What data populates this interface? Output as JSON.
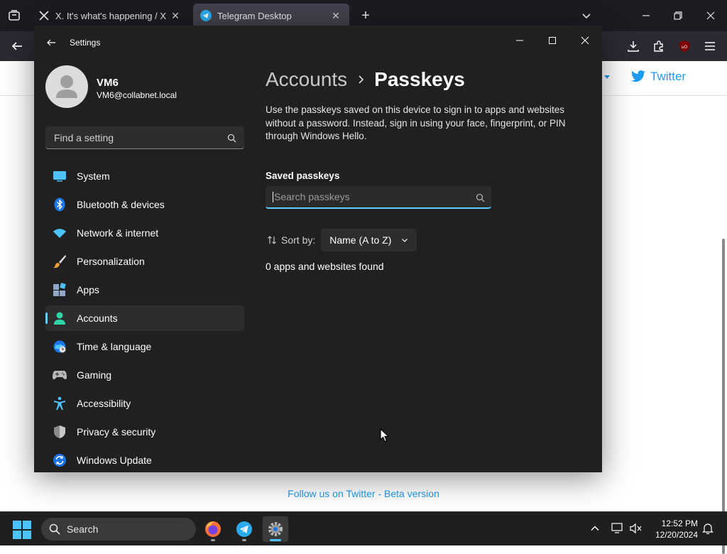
{
  "browser": {
    "tabs": [
      {
        "title": "X. It's what's happening / X",
        "active": false
      },
      {
        "title": "Telegram Desktop",
        "active": true
      }
    ]
  },
  "webpage": {
    "twitter_link": "Twitter",
    "footer_link": "Follow us on Twitter - Beta version"
  },
  "settings": {
    "window_title": "Settings",
    "profile": {
      "name": "VM6",
      "email": "VM6@collabnet.local"
    },
    "find_placeholder": "Find a setting",
    "nav": [
      {
        "label": "System",
        "icon": "monitor-icon",
        "selected": false
      },
      {
        "label": "Bluetooth & devices",
        "icon": "bluetooth-icon",
        "selected": false
      },
      {
        "label": "Network & internet",
        "icon": "wifi-icon",
        "selected": false
      },
      {
        "label": "Personalization",
        "icon": "paintbrush-icon",
        "selected": false
      },
      {
        "label": "Apps",
        "icon": "apps-icon",
        "selected": false
      },
      {
        "label": "Accounts",
        "icon": "person-icon",
        "selected": true
      },
      {
        "label": "Time & language",
        "icon": "globe-clock-icon",
        "selected": false
      },
      {
        "label": "Gaming",
        "icon": "gamepad-icon",
        "selected": false
      },
      {
        "label": "Accessibility",
        "icon": "accessibility-icon",
        "selected": false
      },
      {
        "label": "Privacy & security",
        "icon": "shield-icon",
        "selected": false
      },
      {
        "label": "Windows Update",
        "icon": "sync-icon",
        "selected": false
      }
    ],
    "breadcrumb": {
      "parent": "Accounts",
      "current": "Passkeys"
    },
    "description": "Use the passkeys saved on this device to sign in to apps and websites without a password. Instead, sign in using your face, fingerprint, or PIN through Windows Hello.",
    "saved_passkeys_label": "Saved passkeys",
    "search_placeholder": "Search passkeys",
    "sort_label": "Sort by:",
    "sort_value": "Name (A to Z)",
    "result_count": "0 apps and websites found"
  },
  "taskbar": {
    "search_label": "Search",
    "time": "12:52 PM",
    "date": "12/20/2024"
  },
  "colors": {
    "accent": "#60cdff",
    "window_bg": "#202020",
    "link": "#1d9bf0"
  }
}
